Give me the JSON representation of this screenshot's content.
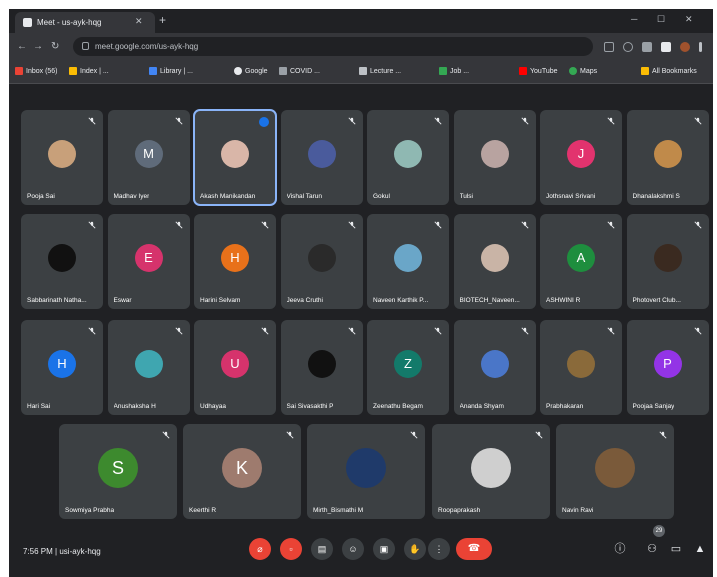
{
  "browser": {
    "tab_title": "Meet - us-ayk-hqg",
    "url": "meet.google.com/us-ayk-hqg",
    "bookmarks": [
      "Inbox (56)",
      "Index | ...",
      "Library | ...",
      "Google",
      "COVID ...",
      "Lecture ...",
      "Job ...",
      "YouTube",
      "Maps",
      "All Bookmarks"
    ]
  },
  "meeting": {
    "clock": "7:56 PM",
    "separator": "|",
    "code": "usi-ayk-hqg"
  },
  "participants": [
    {
      "name": "Pooja Sai",
      "initial": "",
      "color": "#c8a07a",
      "muted": true,
      "speaking": false,
      "active": false
    },
    {
      "name": "Madhav Iyer",
      "initial": "M",
      "color": "#5f6b7a",
      "muted": true,
      "speaking": false,
      "active": false
    },
    {
      "name": "Akash Manikandan",
      "initial": "",
      "color": "#d9b6a8",
      "muted": false,
      "speaking": true,
      "active": true
    },
    {
      "name": "Vishal Tarun",
      "initial": "",
      "color": "#4a5b9c",
      "muted": true,
      "speaking": false,
      "active": false
    },
    {
      "name": "Gokul",
      "initial": "",
      "color": "#8fb8b2",
      "muted": true,
      "speaking": false,
      "active": false
    },
    {
      "name": "Tulsi",
      "initial": "",
      "color": "#b8a3a0",
      "muted": true,
      "speaking": false,
      "active": false
    },
    {
      "name": "Jothsnavi Srivani",
      "initial": "J",
      "color": "#e2336e",
      "muted": true,
      "speaking": false,
      "active": false
    },
    {
      "name": "Dhanalakshmi S",
      "initial": "",
      "color": "#c08a4a",
      "muted": true,
      "speaking": false,
      "active": false
    },
    {
      "name": "Sabbarinath Natha...",
      "initial": "",
      "color": "#111111",
      "muted": true,
      "speaking": false,
      "active": false
    },
    {
      "name": "Eswar",
      "initial": "E",
      "color": "#d6336c",
      "muted": true,
      "speaking": false,
      "active": false
    },
    {
      "name": "Harini Selvam",
      "initial": "H",
      "color": "#e8711a",
      "muted": true,
      "speaking": false,
      "active": false
    },
    {
      "name": "Jeeva Cruthi",
      "initial": "",
      "color": "#2a2a2a",
      "muted": true,
      "speaking": false,
      "active": false
    },
    {
      "name": "Naveen Karthik P...",
      "initial": "",
      "color": "#6aa6c8",
      "muted": true,
      "speaking": false,
      "active": false
    },
    {
      "name": "BIOTECH_Naveen...",
      "initial": "",
      "color": "#c9b4a6",
      "muted": true,
      "speaking": false,
      "active": false
    },
    {
      "name": "ASHWINI R",
      "initial": "A",
      "color": "#1e8e3e",
      "muted": true,
      "speaking": false,
      "active": false
    },
    {
      "name": "Photovert Club...",
      "initial": "",
      "color": "#3a2a20",
      "muted": true,
      "speaking": false,
      "active": false
    },
    {
      "name": "Hari Sai",
      "initial": "H",
      "color": "#1a73e8",
      "muted": true,
      "speaking": false,
      "active": false
    },
    {
      "name": "Anushaksha H",
      "initial": "",
      "color": "#3fa6b0",
      "muted": true,
      "speaking": false,
      "active": false
    },
    {
      "name": "Udhayaa",
      "initial": "U",
      "color": "#d6336c",
      "muted": true,
      "speaking": false,
      "active": false
    },
    {
      "name": "Sai Sivasakthi P",
      "initial": "",
      "color": "#111111",
      "muted": true,
      "speaking": false,
      "active": false
    },
    {
      "name": "Zeenathu Begam",
      "initial": "Z",
      "color": "#137a6a",
      "muted": true,
      "speaking": false,
      "active": false
    },
    {
      "name": "Ananda Shyam",
      "initial": "",
      "color": "#4a76c8",
      "muted": true,
      "speaking": false,
      "active": false
    },
    {
      "name": "Prabhakaran",
      "initial": "",
      "color": "#8a6a3a",
      "muted": true,
      "speaking": false,
      "active": false
    },
    {
      "name": "Poojaa Sanjay",
      "initial": "P",
      "color": "#9334e6",
      "muted": true,
      "speaking": false,
      "active": false
    },
    {
      "name": "Sowmiya Prabha",
      "initial": "S",
      "color": "#3d8a2e",
      "muted": true,
      "speaking": false,
      "active": false
    },
    {
      "name": "Keerthi R",
      "initial": "K",
      "color": "#9e7b6e",
      "muted": true,
      "speaking": false,
      "active": false
    },
    {
      "name": "Mirth_Bismathi M",
      "initial": "",
      "color": "#1f3a6a",
      "muted": true,
      "speaking": false,
      "active": false
    },
    {
      "name": "Roopaprakash",
      "initial": "",
      "color": "#cfcfcf",
      "muted": true,
      "speaking": false,
      "active": false
    },
    {
      "name": "Navin Ravi",
      "initial": "",
      "color": "#7a5a3a",
      "muted": true,
      "speaking": false,
      "active": false
    }
  ],
  "controls": {
    "people_count": "29"
  },
  "colors": {
    "background": "#202124",
    "tile": "#3c4043",
    "accent": "#8ab4f8",
    "danger": "#ea4335"
  },
  "icons": [
    "mic-off-icon",
    "camera-off-icon",
    "captions-icon",
    "emoji-icon",
    "present-icon",
    "raise-hand-icon",
    "more-options-icon",
    "hang-up-icon",
    "info-icon",
    "people-icon",
    "chat-icon",
    "activities-icon"
  ]
}
